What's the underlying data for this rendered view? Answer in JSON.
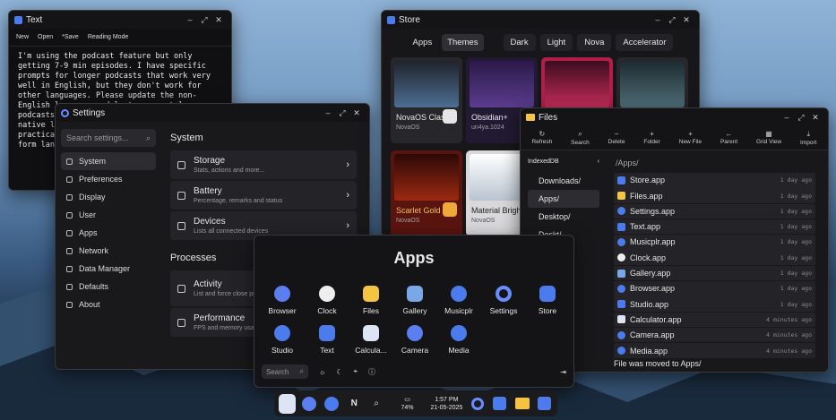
{
  "text_app": {
    "title": "Text",
    "menu": [
      "New",
      "Open",
      "*Save",
      "Reading Mode"
    ],
    "body": "I'm using the podcast feature but only getting 7-9 min episodes. I have specific prompts for longer podcasts that work very well in English, but they don't work for other languages. Please update the non-English language models to support longer podcasts. It's really being able to use my native language. Just the app is not practical for long-form practical for long-form languages."
  },
  "settings": {
    "title": "Settings",
    "search_placeholder": "Search settings...",
    "sidebar": [
      "System",
      "Preferences",
      "Display",
      "User",
      "Apps",
      "Network",
      "Data Manager",
      "Defaults",
      "About"
    ],
    "section_system": "System",
    "system_items": [
      {
        "title": "Storage",
        "sub": "Stats, actions and more..."
      },
      {
        "title": "Battery",
        "sub": "Percentage, remarks and status"
      },
      {
        "title": "Devices",
        "sub": "Lists all connected devices"
      }
    ],
    "section_processes": "Processes",
    "process_items": [
      {
        "title": "Activity",
        "sub": "List and force close processes"
      },
      {
        "title": "Performance",
        "sub": "FPS and memory usage"
      }
    ]
  },
  "store": {
    "title": "Store",
    "tabs": [
      "Apps",
      "Themes"
    ],
    "filters": [
      "Dark",
      "Light",
      "Nova",
      "Accelerator"
    ],
    "themes": [
      {
        "name": "NovaOS Classic",
        "author": "NovaOS"
      },
      {
        "name": "Obsidian+",
        "author": "un4ya.1024"
      },
      {
        "name": "",
        "author": ""
      },
      {
        "name": "",
        "author": ""
      },
      {
        "name": "Scarlet Gold",
        "author": "NovaOS"
      },
      {
        "name": "Material Bright",
        "author": "NovaOS"
      }
    ]
  },
  "files": {
    "title": "Files",
    "toolbar": [
      "Refresh",
      "Search",
      "Delete",
      "Folder",
      "New File",
      "Parent",
      "Grid View",
      "Import"
    ],
    "drive": "IndexedDB",
    "tree": [
      "Downloads/",
      "Apps/",
      "Desktop/",
      "Deskt/"
    ],
    "path": "/Apps/",
    "rows": [
      {
        "name": "Store.app",
        "time": "1 day ago"
      },
      {
        "name": "Files.app",
        "time": "1 day ago"
      },
      {
        "name": "Settings.app",
        "time": "1 day ago"
      },
      {
        "name": "Text.app",
        "time": "1 day ago"
      },
      {
        "name": "Musicplr.app",
        "time": "1 day ago"
      },
      {
        "name": "Clock.app",
        "time": "1 day ago"
      },
      {
        "name": "Gallery.app",
        "time": "1 day ago"
      },
      {
        "name": "Browser.app",
        "time": "1 day ago"
      },
      {
        "name": "Studio.app",
        "time": "1 day ago"
      },
      {
        "name": "Calculator.app",
        "time": "4 minutes ago"
      },
      {
        "name": "Camera.app",
        "time": "4 minutes ago"
      },
      {
        "name": "Media.app",
        "time": "4 minutes ago"
      }
    ],
    "status": "File was moved to Apps/"
  },
  "apps_launcher": {
    "title": "Apps",
    "apps": [
      "Browser",
      "Clock",
      "Files",
      "Gallery",
      "Musicplr",
      "Settings",
      "Store",
      "Studio",
      "Text",
      "Calcula...",
      "Camera",
      "Media"
    ],
    "search_label": "Search"
  },
  "taskbar": {
    "battery": "74%",
    "time": "1:57 PM",
    "date": "21-05-2025",
    "n_label": "N"
  },
  "colors": {
    "accent": "#4b7bec",
    "folder": "#f5c542"
  }
}
